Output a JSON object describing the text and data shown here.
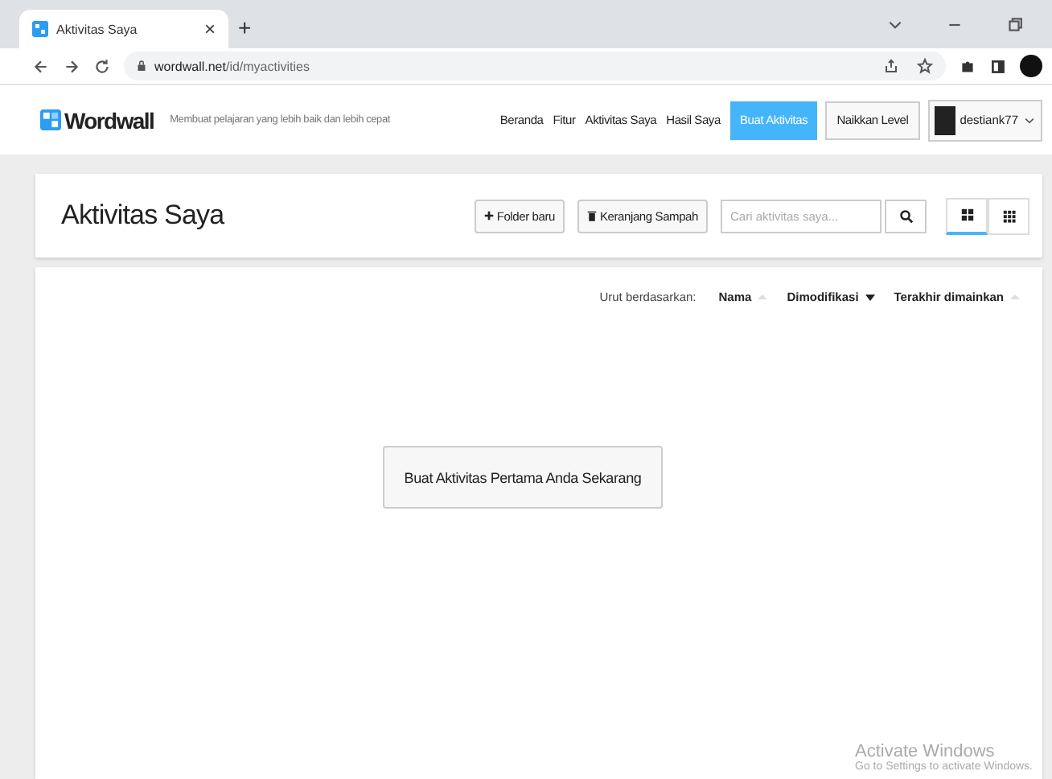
{
  "browser": {
    "tab_title": "Aktivitas Saya",
    "tab_close": "×",
    "new_tab": "+",
    "url_host": "wordwall.net",
    "url_path": "/id/myactivities"
  },
  "site_header": {
    "logo": "Wordwall",
    "tagline": "Membuat pelajaran yang lebih baik dan lebih cepat",
    "nav": [
      {
        "label": "Beranda",
        "kind": "link"
      },
      {
        "label": "Fitur",
        "kind": "link"
      },
      {
        "label": "Aktivitas Saya",
        "kind": "link"
      },
      {
        "label": "Hasil Saya",
        "kind": "link"
      },
      {
        "label": "Buat Aktivitas",
        "kind": "primary"
      },
      {
        "label": "Naikkan Level",
        "kind": "outline"
      }
    ],
    "user": "destiank77"
  },
  "page": {
    "title": "Aktivitas Saya",
    "folder_button": "Folder baru",
    "trash_button": "Keranjang Sampah",
    "search": {
      "placeholder": "Cari aktivitas saya..."
    },
    "views": [
      {
        "kind": "large",
        "selected": true
      },
      {
        "kind": "small",
        "selected": false
      }
    ]
  },
  "sort": {
    "label": "Urut berdasarkan:",
    "options": [
      {
        "label": "Nama",
        "selected": false
      },
      {
        "label": "Dimodifikasi",
        "selected": true
      },
      {
        "label": "Terakhir dimainkan",
        "selected": false
      }
    ]
  },
  "empty_button": "Buat Aktivitas Pertama Anda Sekarang",
  "os_notice": {
    "title": "Activate Windows",
    "text": "Go to Settings to activate Windows."
  }
}
